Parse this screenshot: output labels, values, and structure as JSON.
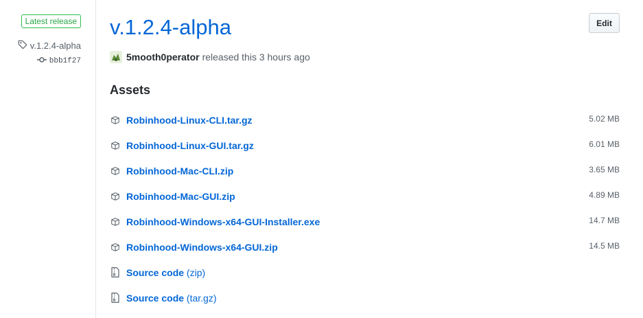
{
  "sidebar": {
    "badge": "Latest release",
    "tag": "v.1.2.4-alpha",
    "commit": "bbb1f27"
  },
  "release": {
    "title": "v.1.2.4-alpha",
    "edit_label": "Edit",
    "author": "5mooth0perator",
    "released_text": "released this 3 hours ago"
  },
  "assets": {
    "heading": "Assets",
    "files": [
      {
        "name": "Robinhood-Linux-CLI.tar.gz",
        "size": "5.02 MB"
      },
      {
        "name": "Robinhood-Linux-GUI.tar.gz",
        "size": "6.01 MB"
      },
      {
        "name": "Robinhood-Mac-CLI.zip",
        "size": "3.65 MB"
      },
      {
        "name": "Robinhood-Mac-GUI.zip",
        "size": "4.89 MB"
      },
      {
        "name": "Robinhood-Windows-x64-GUI-Installer.exe",
        "size": "14.7 MB"
      },
      {
        "name": "Robinhood-Windows-x64-GUI.zip",
        "size": "14.5 MB"
      }
    ],
    "source": [
      {
        "label": "Source code",
        "format": "(zip)"
      },
      {
        "label": "Source code",
        "format": "(tar.gz)"
      }
    ]
  },
  "colors": {
    "link": "#0366d6",
    "badge_green": "#28a745",
    "text_muted": "#586069"
  },
  "icons": {
    "tag": "tag-icon",
    "commit": "git-commit-icon",
    "asset": "package-icon",
    "source": "file-zip-icon"
  }
}
